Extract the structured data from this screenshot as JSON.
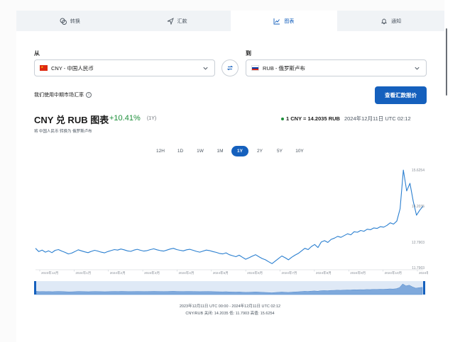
{
  "tabs": [
    {
      "label": "转换",
      "icon": "convert-icon"
    },
    {
      "label": "汇款",
      "icon": "send-icon"
    },
    {
      "label": "图表",
      "icon": "chart-icon"
    },
    {
      "label": "通知",
      "icon": "bell-icon"
    }
  ],
  "from": {
    "label": "从",
    "value": "CNY - 中国人民币"
  },
  "to": {
    "label": "到",
    "value": "RUB - 俄罗斯卢布"
  },
  "mid_market_text": "我们使用中期市场汇率",
  "quote_button": "查看汇款报价",
  "chart_header": {
    "title": "CNY 兑 RUB 图表",
    "change": "+10.41%",
    "period": "(1Y)",
    "subtitle": "将 中国人民币 转换为 俄罗斯卢布",
    "rate": "1 CNY = 14.2035 RUB",
    "timestamp": "2024年12月11日 UTC 02:12"
  },
  "ranges": [
    "12H",
    "1D",
    "1W",
    "1M",
    "1Y",
    "2Y",
    "5Y",
    "10Y"
  ],
  "active_range": "1Y",
  "colors": {
    "accent": "#1560bd",
    "positive": "#1d8f3a",
    "line": "#2a7fd0"
  },
  "chart_data": {
    "type": "line",
    "series": [
      {
        "values": [
          12.55,
          12.42,
          12.48,
          12.4,
          12.45,
          12.38,
          12.47,
          12.5,
          12.44,
          12.39,
          12.33,
          12.36,
          12.42,
          12.49,
          12.45,
          12.41,
          12.38,
          12.43,
          12.47,
          12.44,
          12.4,
          12.37,
          12.42,
          12.46,
          12.5,
          12.48,
          12.52,
          12.49,
          12.45,
          12.43,
          12.48,
          12.51,
          12.47,
          12.44,
          12.46,
          12.5,
          12.53,
          12.49,
          12.46,
          12.44,
          12.48,
          12.52,
          12.55,
          12.5,
          12.47,
          12.45,
          12.49,
          12.51,
          12.47,
          12.43,
          12.4,
          12.44,
          12.48,
          12.46,
          12.42,
          12.39,
          12.35,
          12.33,
          12.37,
          12.3,
          12.26,
          12.22,
          12.28,
          12.2,
          12.12,
          12.18,
          12.24,
          12.3,
          12.22,
          12.15,
          12.1,
          12.02,
          11.95,
          12.05,
          12.15,
          12.25,
          12.18,
          12.1,
          12.2,
          12.28,
          12.35,
          12.45,
          12.55,
          12.5,
          12.62,
          12.7,
          12.58,
          12.8,
          12.85,
          12.78,
          12.9,
          12.95,
          13.02,
          12.98,
          13.05,
          13.12,
          13.08,
          13.2,
          13.18,
          13.25,
          13.22,
          13.3,
          13.28,
          13.35,
          13.33,
          13.4,
          13.38,
          13.45,
          13.55,
          13.5,
          13.62,
          14.1,
          15.62,
          14.8,
          15.1,
          14.4,
          13.85,
          14.05,
          14.2035
        ],
        "data_labels": [
          "15.6254",
          "14.2035"
        ]
      }
    ],
    "y_ticks": [
      "15.6254",
      "14.2035",
      "12.7903",
      "11.7903"
    ],
    "x_ticks": [
      "2023年12月",
      "2024年1月",
      "2024年2月",
      "2024年3月",
      "2024年4月",
      "2024年5月",
      "2024年6月",
      "2024年7月",
      "2024年8月",
      "2024年9月",
      "2024年10月",
      "2024年12月"
    ],
    "ylim": [
      11.7903,
      15.6254
    ],
    "grid": false,
    "legend": "none"
  },
  "footer": {
    "range_text": "2023年12月11日 UTC 00:00 - 2024年12月11日 UTC 02:12",
    "stats_text": "CNY/RUB 关闭: 14.2035 低: 11.7903 高值: 15.6254"
  }
}
